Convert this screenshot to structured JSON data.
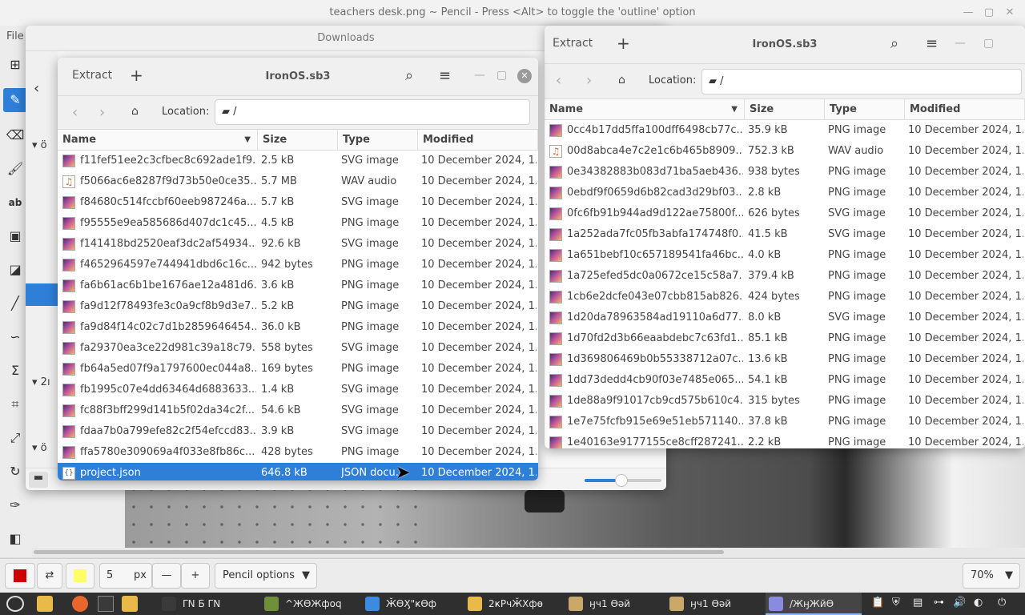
{
  "pencil": {
    "window_title": "teachers desk.png ~ Pencil - Press <Alt> to toggle the 'outline' option",
    "menu_file": "File",
    "brush_size": "5",
    "size_unit": "px",
    "minus": "—",
    "plus": "+",
    "tool_options": "Pencil options",
    "zoom": "70%",
    "primary_color": "#cc0000",
    "secondary_color": "#ffff66"
  },
  "downloads": {
    "title": "Downloads",
    "sidebar_glyphs": [
      "ö",
      "2ı",
      "ö"
    ]
  },
  "left_archive": {
    "extract_label": "Extract",
    "title": "IronOS.sb3",
    "location_label": "Location:",
    "path": "/",
    "columns": [
      "Name",
      "Size",
      "Type",
      "Modified"
    ],
    "rows": [
      {
        "name": "f11fef51ee2c3cfbec8c692ade1f9...",
        "size": "2.5 kB",
        "type": "SVG image",
        "modified": "10 December 2024, 1...",
        "icon": "image"
      },
      {
        "name": "f5066ac6e8287f9d73b50e0ce35...",
        "size": "5.7 MB",
        "type": "WAV audio",
        "modified": "10 December 2024, 1...",
        "icon": "audio"
      },
      {
        "name": "f84680c514fccbf60eeb987246a...",
        "size": "5.7 kB",
        "type": "SVG image",
        "modified": "10 December 2024, 1...",
        "icon": "image"
      },
      {
        "name": "f95555e9ea585686d407dc1c45...",
        "size": "4.5 kB",
        "type": "PNG image",
        "modified": "10 December 2024, 1...",
        "icon": "image"
      },
      {
        "name": "f141418bd2520eaf3dc2af54934...",
        "size": "92.6 kB",
        "type": "SVG image",
        "modified": "10 December 2024, 1...",
        "icon": "image"
      },
      {
        "name": "f4652964597e744941dbd6c16c...",
        "size": "942 bytes",
        "type": "PNG image",
        "modified": "10 December 2024, 1...",
        "icon": "image"
      },
      {
        "name": "fa6b61ac6b1be1676ae12a481d6...",
        "size": "3.6 kB",
        "type": "PNG image",
        "modified": "10 December 2024, 1...",
        "icon": "image"
      },
      {
        "name": "fa9d12f78493fe3c0a9cf8b9d3e7...",
        "size": "5.2 kB",
        "type": "PNG image",
        "modified": "10 December 2024, 1...",
        "icon": "image"
      },
      {
        "name": "fa9d84f14c02c7d1b2859646454...",
        "size": "36.0 kB",
        "type": "PNG image",
        "modified": "10 December 2024, 1...",
        "icon": "image"
      },
      {
        "name": "fa29370ea3ce22d981c39a18c79...",
        "size": "558 bytes",
        "type": "SVG image",
        "modified": "10 December 2024, 1...",
        "icon": "image"
      },
      {
        "name": "fb64a5ed07f9a1797600ec044a8...",
        "size": "169 bytes",
        "type": "PNG image",
        "modified": "10 December 2024, 1...",
        "icon": "image"
      },
      {
        "name": "fb1995c07e4dd63464d6883633...",
        "size": "1.4 kB",
        "type": "SVG image",
        "modified": "10 December 2024, 1...",
        "icon": "image"
      },
      {
        "name": "fc88f3bff299d141b5f02da34c2f...",
        "size": "54.6 kB",
        "type": "SVG image",
        "modified": "10 December 2024, 1...",
        "icon": "image"
      },
      {
        "name": "fdaa7b0a799efe82c2f54efccd83...",
        "size": "3.9 kB",
        "type": "SVG image",
        "modified": "10 December 2024, 1...",
        "icon": "image"
      },
      {
        "name": "ffa5780e309069a4f033e8fb86c...",
        "size": "428 bytes",
        "type": "PNG image",
        "modified": "10 December 2024, 1...",
        "icon": "image"
      },
      {
        "name": "project.json",
        "size": "646.8 kB",
        "type": "JSON docu...",
        "modified": "10 December 2024, 1...",
        "icon": "json",
        "selected": true
      }
    ]
  },
  "right_archive": {
    "extract_label": "Extract",
    "title": "IronOS.sb3",
    "location_label": "Location:",
    "path": "/",
    "columns": [
      "Name",
      "Size",
      "Type",
      "Modified"
    ],
    "rows": [
      {
        "name": "0cc4b17dd5ffa100dff6498cb77c...",
        "size": "35.9 kB",
        "type": "PNG image",
        "modified": "10 December 2024, 1...",
        "icon": "image"
      },
      {
        "name": "00d8abca4e7c2e1c6b465b8909...",
        "size": "752.3 kB",
        "type": "WAV audio",
        "modified": "10 December 2024, 1...",
        "icon": "audio"
      },
      {
        "name": "0e34382883b083d71ba5aeb436...",
        "size": "938 bytes",
        "type": "PNG image",
        "modified": "10 December 2024, 1...",
        "icon": "image"
      },
      {
        "name": "0ebdf9f0659d6b82cad3d29bf03...",
        "size": "2.8 kB",
        "type": "PNG image",
        "modified": "10 December 2024, 1...",
        "icon": "image"
      },
      {
        "name": "0fc6fb91b944ad9d122ae75800f...",
        "size": "626 bytes",
        "type": "SVG image",
        "modified": "10 December 2024, 1...",
        "icon": "image"
      },
      {
        "name": "1a252ada7fc05fb3abfa174748f0...",
        "size": "41.5 kB",
        "type": "SVG image",
        "modified": "10 December 2024, 1...",
        "icon": "image"
      },
      {
        "name": "1a651bebf10c657189541fa46bc...",
        "size": "4.0 kB",
        "type": "PNG image",
        "modified": "10 December 2024, 1...",
        "icon": "image"
      },
      {
        "name": "1a725efed5dc0a0672ce15c58a7...",
        "size": "379.4 kB",
        "type": "PNG image",
        "modified": "10 December 2024, 1...",
        "icon": "image"
      },
      {
        "name": "1cb6e2dcfe043e07cbb815ab826...",
        "size": "424 bytes",
        "type": "PNG image",
        "modified": "10 December 2024, 1...",
        "icon": "image"
      },
      {
        "name": "1d20da78963584ad19110a6d77...",
        "size": "8.0 kB",
        "type": "SVG image",
        "modified": "10 December 2024, 1...",
        "icon": "image"
      },
      {
        "name": "1d70fd2d3b66eaabdebc7c63fd1...",
        "size": "85.1 kB",
        "type": "PNG image",
        "modified": "10 December 2024, 1...",
        "icon": "image"
      },
      {
        "name": "1d369806469b0b55338712a07c...",
        "size": "13.6 kB",
        "type": "PNG image",
        "modified": "10 December 2024, 1...",
        "icon": "image"
      },
      {
        "name": "1dd73dedd4cb90f03e7485e065...",
        "size": "54.1 kB",
        "type": "PNG image",
        "modified": "10 December 2024, 1...",
        "icon": "image"
      },
      {
        "name": "1de88a9f91017cb9cd575b610c4...",
        "size": "315 bytes",
        "type": "PNG image",
        "modified": "10 December 2024, 1...",
        "icon": "image"
      },
      {
        "name": "1e7e75fcfb915e69e51eb571140...",
        "size": "37.8 kB",
        "type": "PNG image",
        "modified": "10 December 2024, 1...",
        "icon": "image"
      },
      {
        "name": "1e40163e9177155ce8cff287241...",
        "size": "2.2 kB",
        "type": "PNG image",
        "modified": "10 December 2024, 1...",
        "icon": "image"
      }
    ]
  },
  "taskbar": {
    "items": [
      {
        "label": "ΓΝ  Б ΓΝ",
        "icon_color": "#3a3a3a"
      },
      {
        "label": "^ЖӨЖфoq",
        "icon_color": "#6f8f3a"
      },
      {
        "label": "ӁӨӼ\"ҝӨф",
        "icon_color": "#3d8be0"
      },
      {
        "label": "2ҝPчӁХфө",
        "icon_color": "#e9b949"
      },
      {
        "label": "ӈч1 Ѳəй",
        "icon_color": "#c9a86a"
      },
      {
        "label": "ӈч1 Ѳəй",
        "icon_color": "#c9a86a"
      },
      {
        "label": "/ЖӈЖйӨ",
        "icon_color": "#8a8ae0"
      }
    ],
    "clock_hint": "",
    "tray_icons": [
      "clipboard-icon",
      "shield-icon",
      "document-icon",
      "network-icon",
      "volume-icon",
      "power-icon"
    ]
  }
}
